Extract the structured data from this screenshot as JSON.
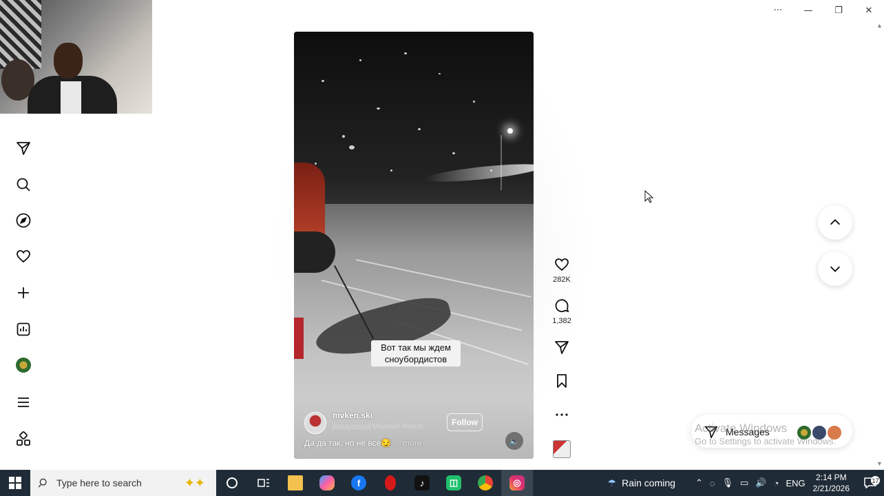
{
  "window": {
    "controls": {
      "more": "···",
      "minimize": "—",
      "restore": "❐",
      "close": "✕"
    }
  },
  "nav": {
    "items": [
      {
        "id": "direct",
        "icon": "paper-plane-icon"
      },
      {
        "id": "search",
        "icon": "search-icon"
      },
      {
        "id": "explore",
        "icon": "compass-icon"
      },
      {
        "id": "notifications",
        "icon": "heart-icon"
      },
      {
        "id": "create",
        "icon": "plus-icon"
      },
      {
        "id": "dashboard",
        "icon": "chart-icon"
      },
      {
        "id": "profile",
        "icon": "avatar-icon"
      },
      {
        "id": "more",
        "icon": "menu-icon"
      },
      {
        "id": "also-from-meta",
        "icon": "apps-icon"
      }
    ]
  },
  "reel": {
    "caption_overlay": "Вот так мы ждем сноубордистов",
    "username": "mvken.ski",
    "location": "Дурдурдурд Mountain Resort",
    "follow_label": "Follow",
    "description": "Да да так, но не все😏",
    "more_label": "... more",
    "likes": "282K",
    "comments": "1,382"
  },
  "messages": {
    "label": "Messages"
  },
  "watermark": {
    "line1": "Activate Windows",
    "line2": "Go to Settings to activate Windows."
  },
  "taskbar": {
    "search_placeholder": "Type here to search",
    "weather": "Rain coming",
    "language": "ENG",
    "time": "2:14 PM",
    "date": "2/21/2026",
    "notification_count": "17"
  },
  "colors": {
    "taskbar": "#1f2b36",
    "search_box": "#f2f2f2",
    "instagram_gradient_start": "#f9a03c",
    "instagram_gradient_end": "#c13584"
  }
}
